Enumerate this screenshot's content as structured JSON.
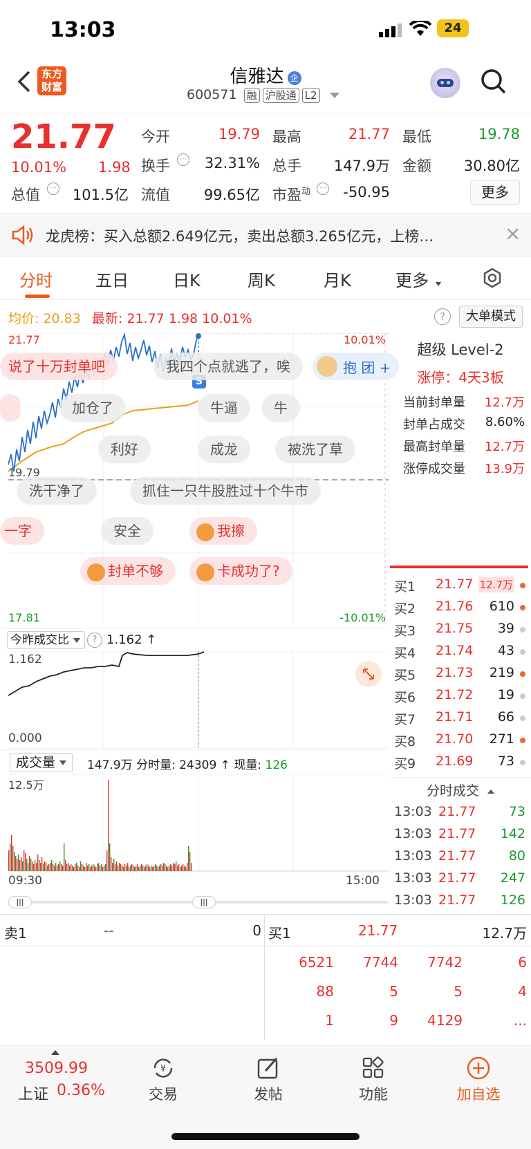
{
  "status": {
    "time": "13:03",
    "battery": "24"
  },
  "header": {
    "back": "<",
    "logo_line1": "东方",
    "logo_line2": "财富",
    "stock_name": "信雅达",
    "badge": "企",
    "code": "600571",
    "tags": [
      "融",
      "沪股通",
      "L2"
    ]
  },
  "quote": {
    "price": "21.77",
    "pct": "10.01%",
    "chg": "1.98",
    "labels": {
      "open": "今开",
      "high": "最高",
      "low": "最低",
      "turnover": "换手",
      "volume": "总手",
      "amount": "金额",
      "mcap": "总值",
      "float": "流值",
      "pe": "市盈"
    },
    "values": {
      "open": "19.79",
      "high": "21.77",
      "low": "19.78",
      "turnover": "32.31%",
      "volume": "147.9万",
      "amount": "30.80亿",
      "mcap": "101.5亿",
      "float": "99.65亿",
      "pe": "-50.95"
    },
    "pe_sup": "动",
    "more": "更多"
  },
  "dragon": {
    "text": "龙虎榜：买入总额2.649亿元，卖出总额3.265亿元，上榜…",
    "close": "×"
  },
  "tabs": [
    "分时",
    "五日",
    "日K",
    "周K",
    "月K",
    "更多"
  ],
  "chart": {
    "avg_label": "均价:",
    "avg": "20.83",
    "last_label": "最新:",
    "last": "21.77",
    "last_chg": "1.98",
    "last_pct": "10.01%",
    "help": "?",
    "big_order": "大单模式",
    "top_price": "21.77",
    "top_pct": "10.01%",
    "mid_price": "19.79",
    "bottom_price": "17.81",
    "bottom_pct": "-10.01%",
    "s_marker": "S"
  },
  "bubbles": [
    "说了十万封单吧",
    "我四个点就逃了，唉",
    "抱 团 +",
    "加仓了",
    "牛逼",
    "牛",
    "利好",
    "成龙",
    "被洗了草",
    "洗干净了",
    "抓住一只牛股胜过十个牛市",
    "一字",
    "安全",
    "我擦",
    "封单不够",
    "卡成功了?"
  ],
  "ratio": {
    "label": "今昨成交比",
    "help": "?",
    "value": "1.162 ↑",
    "top": "1.162",
    "bottom": "0.000"
  },
  "volume": {
    "label": "成交量",
    "total": "147.9万",
    "fs_label": "分时量:",
    "fs": "24309 ↑",
    "now_label": "现量:",
    "now": "126",
    "max": "12.5万",
    "start": "09:30",
    "end": "15:00"
  },
  "level2": {
    "title": "超级 Level-2",
    "limit": "涨停：4天3板",
    "rows": [
      {
        "k": "当前封单量",
        "v": "12.7万"
      },
      {
        "k": "封单占成交",
        "v": "8.60%"
      },
      {
        "k": "最高封单量",
        "v": "12.7万"
      },
      {
        "k": "涨停成交量",
        "v": "13.9万"
      }
    ]
  },
  "orderbook": [
    {
      "l": "买1",
      "p": "21.77",
      "q": "12.7万"
    },
    {
      "l": "买2",
      "p": "21.76",
      "q": "610"
    },
    {
      "l": "买3",
      "p": "21.75",
      "q": "39"
    },
    {
      "l": "买4",
      "p": "21.74",
      "q": "43"
    },
    {
      "l": "买5",
      "p": "21.73",
      "q": "219"
    },
    {
      "l": "买6",
      "p": "21.72",
      "q": "19"
    },
    {
      "l": "买7",
      "p": "21.71",
      "q": "66"
    },
    {
      "l": "买8",
      "p": "21.70",
      "q": "271"
    },
    {
      "l": "买9",
      "p": "21.69",
      "q": "73"
    }
  ],
  "trades_title": "分时成交",
  "trades": [
    {
      "t": "13:03",
      "p": "21.77",
      "q": "73"
    },
    {
      "t": "13:03",
      "p": "21.77",
      "q": "142"
    },
    {
      "t": "13:03",
      "p": "21.77",
      "q": "80"
    },
    {
      "t": "13:03",
      "p": "21.77",
      "q": "247"
    },
    {
      "t": "13:03",
      "p": "21.77",
      "q": "126"
    }
  ],
  "queue": {
    "sell_label": "卖1",
    "sell_price": "--",
    "sell_qty": "0",
    "buy_label": "买1",
    "buy_price": "21.77",
    "buy_qty": "12.7万",
    "rows": [
      [
        "6521",
        "7744",
        "7742",
        "6"
      ],
      [
        "88",
        "5",
        "5",
        "4"
      ],
      [
        "1",
        "9",
        "4129",
        "..."
      ]
    ]
  },
  "bottom": {
    "index_value": "3509.99",
    "index_name": "上证",
    "index_pct": "0.36%",
    "nav": [
      "交易",
      "发帖",
      "功能",
      "加自选"
    ]
  }
}
